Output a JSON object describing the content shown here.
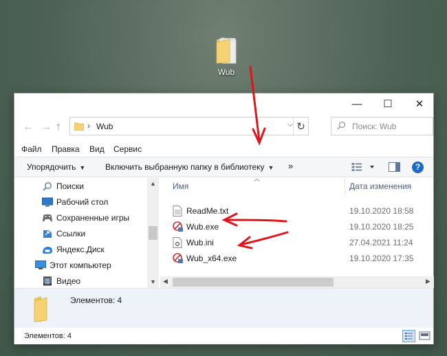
{
  "desktop": {
    "folder_label": "Wub"
  },
  "window": {
    "controls": {
      "minimize": "—",
      "maximize": "☐",
      "close": "✕"
    },
    "nav": {
      "back": "←",
      "forward": "→",
      "up": "↑"
    },
    "address": {
      "separator": "›",
      "path": "Wub",
      "dropdown": "⌵",
      "refresh": "↻"
    },
    "search": {
      "placeholder": "Поиск: Wub"
    },
    "menu": {
      "file": "Файл",
      "edit": "Правка",
      "view": "Вид",
      "service": "Сервис"
    },
    "toolbar": {
      "organize": "Упорядочить",
      "include": "Включить выбранную папку в библиотеку",
      "more": "»",
      "help": "?"
    },
    "nav_pane": [
      {
        "label": "Поиски",
        "icon": "search-icon"
      },
      {
        "label": "Рабочий стол",
        "icon": "desktop-icon"
      },
      {
        "label": "Сохраненные игры",
        "icon": "saved-games-icon"
      },
      {
        "label": "Ссылки",
        "icon": "links-icon"
      },
      {
        "label": "Яндекс.Диск",
        "icon": "yandex-disk-icon"
      },
      {
        "label": "Этот компьютер",
        "icon": "computer-icon"
      },
      {
        "label": "Видео",
        "icon": "video-icon"
      }
    ],
    "columns": {
      "name": "Имя",
      "date": "Дата изменения"
    },
    "files": [
      {
        "name": "ReadMe.txt",
        "date": "19.10.2020 18:58",
        "icon": "text-file-icon"
      },
      {
        "name": "Wub.exe",
        "date": "19.10.2020 18:25",
        "icon": "exe-file-icon"
      },
      {
        "name": "Wub.ini",
        "date": "27.04.2021 11:24",
        "icon": "settings-file-icon"
      },
      {
        "name": "Wub_x64.exe",
        "date": "19.10.2020 17:35",
        "icon": "exe-file-icon"
      }
    ],
    "details": {
      "count": "Элементов: 4"
    },
    "status": {
      "count": "Элементов: 4"
    }
  },
  "colors": {
    "annotation_arrow": "#e0141b",
    "header_text": "#4c607a",
    "details_bg": "#eef3fa"
  }
}
